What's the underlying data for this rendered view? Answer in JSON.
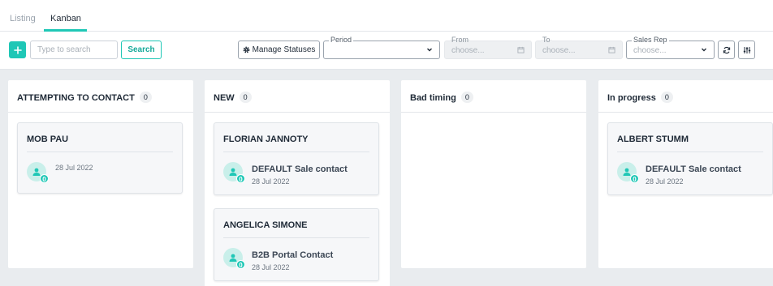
{
  "tabs": [
    {
      "label": "Listing",
      "active": false
    },
    {
      "label": "Kanban",
      "active": true
    }
  ],
  "toolbar": {
    "add_icon": "plus-icon",
    "search_placeholder": "Type to search",
    "search_value": "",
    "search_button": "Search",
    "manage_statuses": "Manage Statuses",
    "period": {
      "label": "Period",
      "value": ""
    },
    "from": {
      "label": "From",
      "placeholder": "choose..."
    },
    "to": {
      "label": "To",
      "placeholder": "choose..."
    },
    "sales_rep": {
      "label": "Sales Rep",
      "placeholder": "choose..."
    }
  },
  "columns": [
    {
      "title": "ATTEMPTING TO CONTACT",
      "count": "0",
      "cards": [
        {
          "name": "MOB PAU",
          "contact": "",
          "date": "28 Jul 2022",
          "badge": "0"
        }
      ]
    },
    {
      "title": "NEW",
      "count": "0",
      "cards": [
        {
          "name": "FLORIAN JANNOTY",
          "contact": "DEFAULT Sale contact",
          "date": "28 Jul 2022",
          "badge": "0"
        },
        {
          "name": "ANGELICA SIMONE",
          "contact": "B2B Portal Contact",
          "date": "28 Jul 2022",
          "badge": "0"
        }
      ]
    },
    {
      "title": "Bad timing",
      "count": "0",
      "cards": []
    },
    {
      "title": "In progress",
      "count": "0",
      "cards": [
        {
          "name": "ALBERT STUMM",
          "contact": "DEFAULT Sale contact",
          "date": "28 Jul 2022",
          "badge": "0"
        }
      ]
    }
  ],
  "colors": {
    "accent": "#1fc7b6",
    "board_bg": "#e9ecef"
  }
}
